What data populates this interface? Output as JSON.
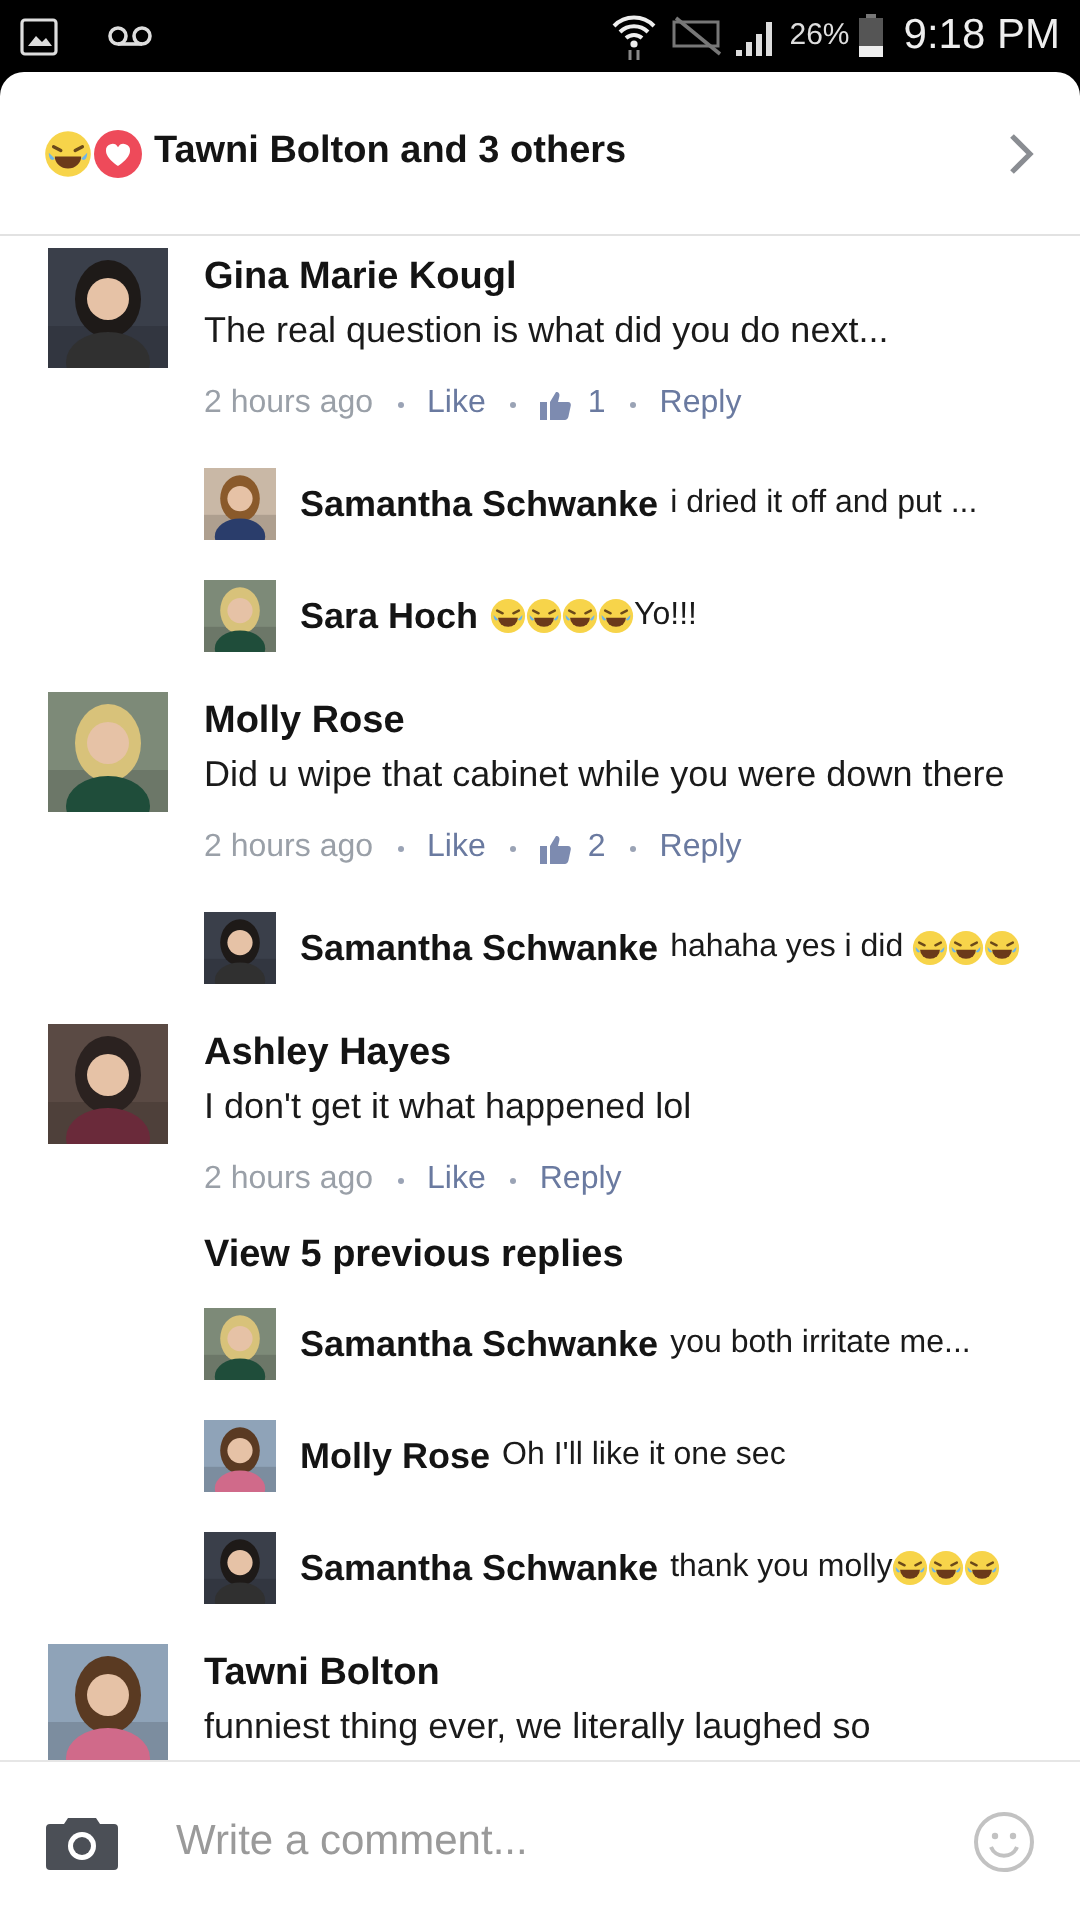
{
  "status_bar": {
    "battery": "26%",
    "time": "9:18 PM"
  },
  "reactions_header": {
    "text": "Tawni Bolton and 3 others"
  },
  "comments": [
    {
      "name": "Gina Marie Kougl",
      "text": "The real question is what did you do next...",
      "time": "2 hours ago",
      "like_label": "Like",
      "like_count": "1",
      "reply_label": "Reply",
      "replies": [
        {
          "name": "Samantha Schwanke",
          "parts": [
            {
              "kind": "text",
              "text": "i dried it off and put ..."
            }
          ]
        },
        {
          "name": "Sara Hoch",
          "parts": [
            {
              "kind": "laugh_emoji"
            },
            {
              "kind": "laugh_emoji"
            },
            {
              "kind": "laugh_emoji"
            },
            {
              "kind": "laugh_emoji"
            },
            {
              "kind": "text",
              "text": "Yo!!!"
            }
          ]
        }
      ]
    },
    {
      "name": "Molly Rose",
      "text": "Did u wipe that cabinet while you were down there",
      "time": "2 hours ago",
      "like_label": "Like",
      "like_count": "2",
      "reply_label": "Reply",
      "replies": [
        {
          "name": "Samantha Schwanke",
          "parts": [
            {
              "kind": "text",
              "text": "hahaha yes i did "
            },
            {
              "kind": "laugh_emoji"
            },
            {
              "kind": "laugh_emoji"
            },
            {
              "kind": "laugh_emoji"
            }
          ]
        }
      ]
    },
    {
      "name": "Ashley Hayes",
      "text": "I don't get it what happened lol",
      "time": "2 hours ago",
      "like_label": "Like",
      "reply_label": "Reply",
      "view_previous": "View 5 previous replies",
      "replies": [
        {
          "name": "Samantha Schwanke",
          "parts": [
            {
              "kind": "text",
              "text": "you both irritate me..."
            }
          ]
        },
        {
          "name": "Molly Rose",
          "parts": [
            {
              "kind": "text",
              "text": "Oh I'll like it one sec"
            }
          ]
        },
        {
          "name": "Samantha Schwanke",
          "parts": [
            {
              "kind": "text",
              "text": "thank you molly"
            },
            {
              "kind": "laugh_emoji"
            },
            {
              "kind": "laugh_emoji"
            },
            {
              "kind": "laugh_emoji"
            }
          ]
        }
      ]
    },
    {
      "name": "Tawni Bolton",
      "text": "funniest thing ever, we literally laughed so"
    }
  ],
  "composer": {
    "placeholder": "Write a comment..."
  }
}
